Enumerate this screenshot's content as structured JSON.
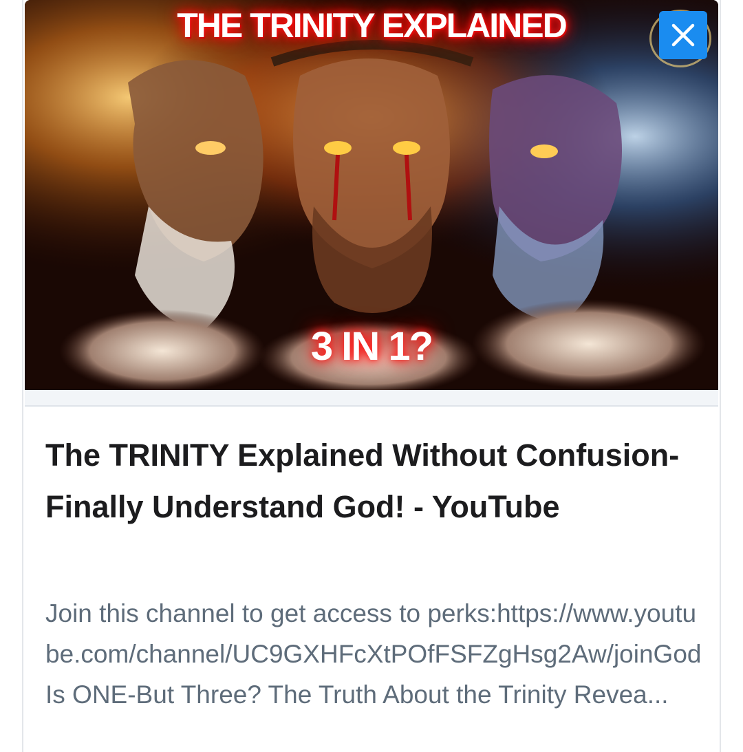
{
  "thumbnail": {
    "headline": "THE TRINITY EXPLAINED",
    "question": "3 IN 1?"
  },
  "close_button": {
    "icon": "close-icon",
    "color": "#1a8cf0"
  },
  "link_preview": {
    "title": "The TRINITY Explained Without Confusion-Finally Understand God! - YouTube",
    "description": "Join this channel to get access to perks:https://www.youtube.com/channel/UC9GXHFcXtPOfFSFZgHsg2Aw/joinGod Is ONE-But Three? The Truth About the Trinity Revea..."
  }
}
